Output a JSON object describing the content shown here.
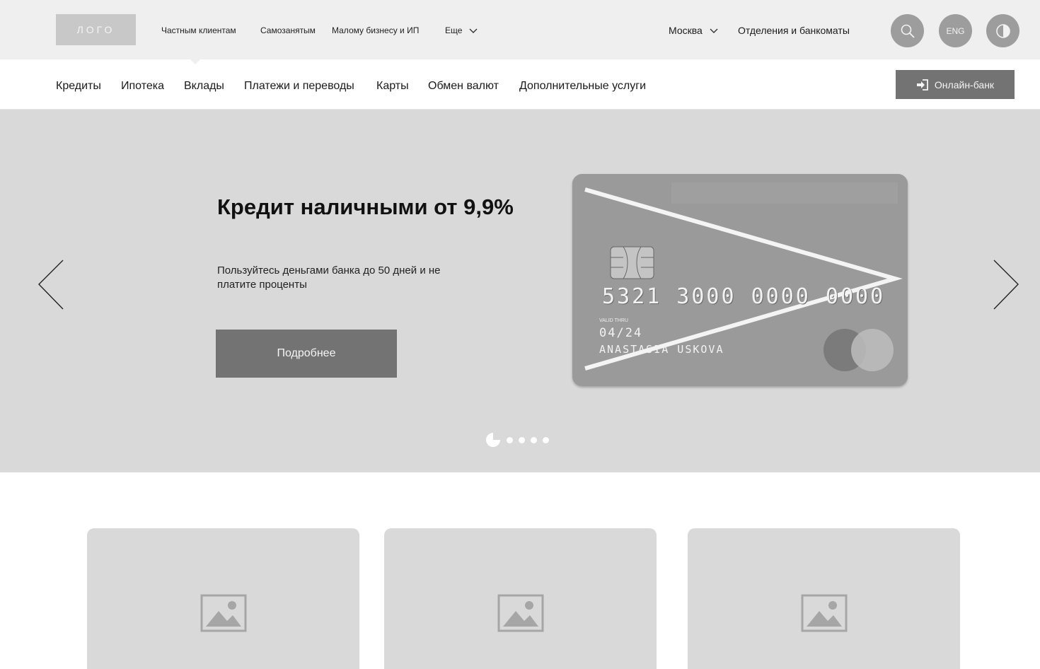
{
  "header": {
    "logo": "ЛОГО",
    "segments": [
      "Частным клиентам",
      "Самозанятым",
      "Малому бизнесу и ИП",
      "Еще"
    ],
    "city": "Москва",
    "branches": "Отделения и банкоматы",
    "lang": "ENG",
    "icons": [
      "search-icon",
      "contrast-icon"
    ]
  },
  "nav": {
    "items": [
      "Кредиты",
      "Ипотека",
      "Вклады",
      "Платежи и переводы",
      "Карты",
      "Обмен валют",
      "Дополнительные услуги"
    ],
    "online_bank": "Онлайн-банк"
  },
  "hero": {
    "title": "Кредит наличными от 9,9%",
    "text": "Пользуйтесь деньгами банка до 50 дней и не платите проценты",
    "button": "Подробнее",
    "slides": 5,
    "active_slide": 1
  },
  "card": {
    "number": "5321 3000 0000 0000",
    "valid_label": "VALID THRU",
    "expiry": "04/24",
    "holder": "ANASTASIA USKOVA"
  },
  "tiles": [
    {
      "icon": "image-placeholder-icon"
    },
    {
      "icon": "image-placeholder-icon"
    },
    {
      "icon": "image-placeholder-icon"
    }
  ],
  "colors": {
    "topbar_bg": "#efefef",
    "hero_bg": "#d9d9d9",
    "button_bg": "#737373",
    "circle_bg": "#9d9d9d"
  }
}
